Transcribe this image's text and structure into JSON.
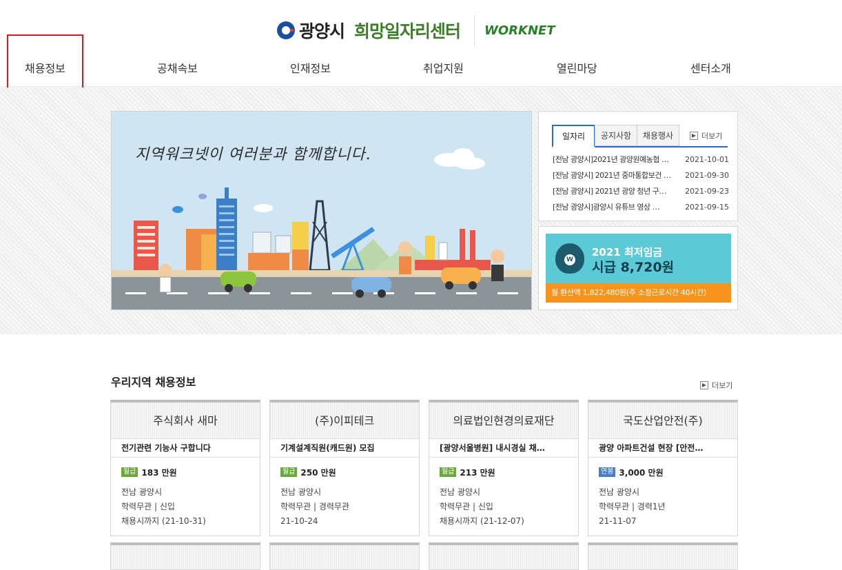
{
  "header": {
    "logo_city": "광양시",
    "logo_center": "희망일자리센터",
    "logo_partner": "WORKNET"
  },
  "nav": [
    {
      "label": "채용정보"
    },
    {
      "label": "공채속보"
    },
    {
      "label": "인재정보"
    },
    {
      "label": "취업지원"
    },
    {
      "label": "열린마당"
    },
    {
      "label": "센터소개"
    }
  ],
  "banner": {
    "headline": "지역워크넷이 여러분과 함께합니다."
  },
  "news": {
    "tabs": [
      "일자리",
      "공지사항",
      "채용행사"
    ],
    "active_tab": "일자리",
    "more_label": "더보기",
    "items": [
      {
        "title": "[전남 광양시]2021년 광양원예농협 …",
        "date": "2021-10-01"
      },
      {
        "title": "[전남 광양시] 2021년 중마통합보건 …",
        "date": "2021-09-30"
      },
      {
        "title": "[전남 광양시] 2021년 광양 청년 구…",
        "date": "2021-09-23"
      },
      {
        "title": "[전남 광양시]광양시 유튜브 영상 …",
        "date": "2021-09-15"
      }
    ]
  },
  "wage": {
    "year_label": "2021 최저임금",
    "hourly": "시급 8,720원",
    "monthly": "월 환산액 1,822,480원(주 소정근로시간 40시간)",
    "bag_mark": "W"
  },
  "jobs": {
    "section_title": "우리지역 채용정보",
    "more_label": "더보기",
    "cards": [
      {
        "company": "주식회사 새마",
        "title": "전기관련 기능사 구합니다",
        "pay_type": "월급",
        "pay": "183 만원",
        "location": "전남 광양시",
        "requirements": "학력무관 | 신입",
        "deadline": "채용시까지 (21-10-31)"
      },
      {
        "company": "(주)이피테크",
        "title": "기계설계직원(캐드원) 모집",
        "pay_type": "월급",
        "pay": "250 만원",
        "location": "전남 광양시",
        "requirements": "학력무관 | 경력무관",
        "deadline": "21-10-24"
      },
      {
        "company": "의료법인현경의료재단",
        "title": "[광양서울병원] 내시경실 채…",
        "pay_type": "월급",
        "pay": "213 만원",
        "location": "전남 광양시",
        "requirements": "학력무관 | 신입",
        "deadline": "채용시까지 (21-12-07)"
      },
      {
        "company": "국도산업안전(주)",
        "title": "광양 아파트건설 현장 [안전…",
        "pay_type": "연봉",
        "pay": "3,000 만원",
        "location": "전남 광양시",
        "requirements": "학력무관 | 경력1년",
        "deadline": "21-11-07"
      }
    ]
  },
  "colors": {
    "accent_blue": "#2a6fbf",
    "brand_green": "#3c7d2a",
    "highlight_red": "#e4141b",
    "wage_teal": "#5cc9d6",
    "wage_orange": "#f7941d"
  }
}
